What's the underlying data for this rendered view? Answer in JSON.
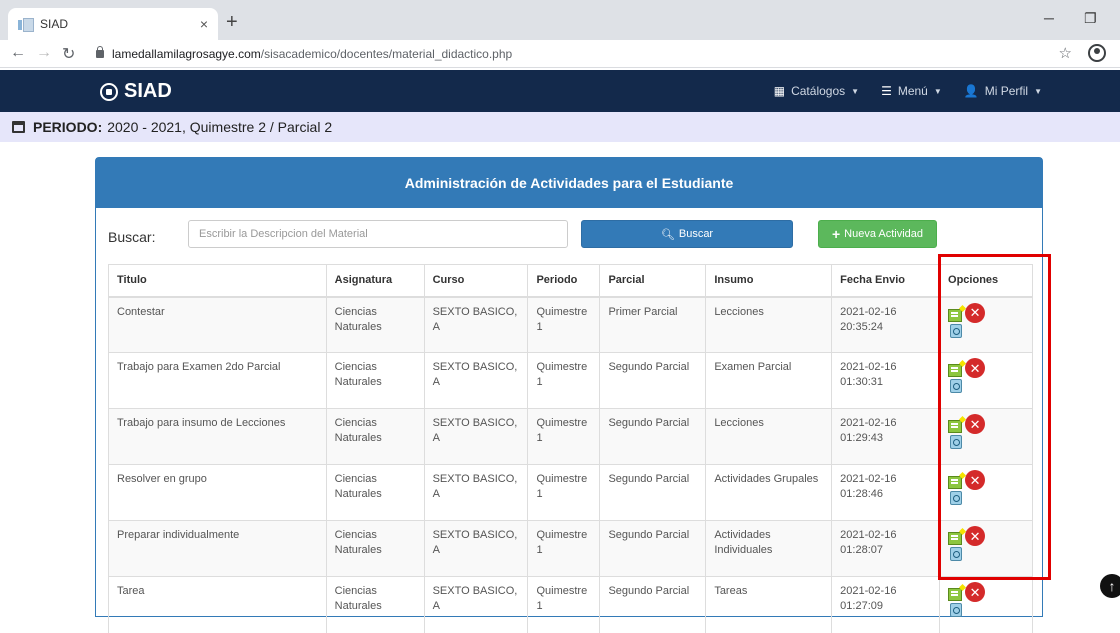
{
  "browser": {
    "tab_title": "SIAD",
    "tab_close": "×",
    "new_tab": "+",
    "url_domain": "lamedallamilagrosagye.com",
    "url_path": "/sisacademico/docentes/material_didactico.php"
  },
  "navbar": {
    "brand": "SIAD",
    "catalogos": "Catálogos",
    "menu": "Menú",
    "perfil": "Mi Perfil"
  },
  "period": {
    "label": "PERIODO:",
    "value": "2020 - 2021, Quimestre 2 / Parcial 2"
  },
  "panel": {
    "title": "Administración de Actividades para el Estudiante",
    "search_label": "Buscar:",
    "search_placeholder": "Escribir la Descripcion del Material",
    "search_button": "Buscar",
    "new_button": "Nueva Actividad"
  },
  "table": {
    "headers": [
      "Titulo",
      "Asignatura",
      "Curso",
      "Periodo",
      "Parcial",
      "Insumo",
      "Fecha Envio",
      "Opciones"
    ],
    "rows": [
      {
        "titulo": "Contestar",
        "asignatura": "Ciencias Naturales",
        "curso": "SEXTO BASICO, A",
        "periodo": "Quimestre 1",
        "parcial": "Primer Parcial",
        "insumo": "Lecciones",
        "fecha": "2021-02-16 20:35:24"
      },
      {
        "titulo": "Trabajo para Examen 2do Parcial",
        "asignatura": "Ciencias Naturales",
        "curso": "SEXTO BASICO, A",
        "periodo": "Quimestre 1",
        "parcial": "Segundo Parcial",
        "insumo": "Examen Parcial",
        "fecha": "2021-02-16 01:30:31"
      },
      {
        "titulo": "Trabajo para insumo de Lecciones",
        "asignatura": "Ciencias Naturales",
        "curso": "SEXTO BASICO, A",
        "periodo": "Quimestre 1",
        "parcial": "Segundo Parcial",
        "insumo": "Lecciones",
        "fecha": "2021-02-16 01:29:43"
      },
      {
        "titulo": "Resolver en grupo",
        "asignatura": "Ciencias Naturales",
        "curso": "SEXTO BASICO, A",
        "periodo": "Quimestre 1",
        "parcial": "Segundo Parcial",
        "insumo": "Actividades Grupales",
        "fecha": "2021-02-16 01:28:46"
      },
      {
        "titulo": "Preparar individualmente",
        "asignatura": "Ciencias Naturales",
        "curso": "SEXTO BASICO, A",
        "periodo": "Quimestre 1",
        "parcial": "Segundo Parcial",
        "insumo": "Actividades Individuales",
        "fecha": "2021-02-16 01:28:07"
      },
      {
        "titulo": "Tarea",
        "asignatura": "Ciencias Naturales",
        "curso": "SEXTO BASICO, A",
        "periodo": "Quimestre 1",
        "parcial": "Segundo Parcial",
        "insumo": "Tareas",
        "fecha": "2021-02-16 01:27:09"
      }
    ]
  },
  "icons": {
    "edit": "edit-icon",
    "delete": "delete-icon",
    "view": "view-icon",
    "scroll_top": "arrow-up-circle-icon"
  },
  "colors": {
    "navbar": "#13294b",
    "panel_primary": "#337ab7",
    "success": "#5cb85c",
    "period_bar": "#e6e6fa",
    "highlight": "#e00000"
  }
}
